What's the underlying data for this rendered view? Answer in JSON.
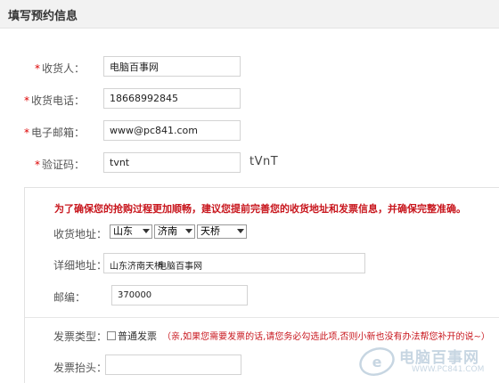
{
  "header": {
    "title": "填写预约信息"
  },
  "form": {
    "required_mark": "*",
    "receiver": {
      "label": "收货人：",
      "value": "电脑百事网"
    },
    "phone": {
      "label": "收货电话：",
      "value": "18668992845"
    },
    "email": {
      "label": "电子邮箱：",
      "value": "www@pc841.com"
    },
    "captcha": {
      "label": "验证码：",
      "value": "tvnt",
      "image_text": "tVnT"
    }
  },
  "panel": {
    "notice": "为了确保您的抢购过程更加顺畅，建议您提前完善您的收货地址和发票信息，并确保完整准确。",
    "region": {
      "label": "收货地址：",
      "province": "山东",
      "city": "济南",
      "district": "天桥"
    },
    "address": {
      "label": "详细地址：",
      "prefix": "山东济南天桥",
      "value": "电脑百事网"
    },
    "postcode": {
      "label": "邮编：",
      "value": "370000"
    },
    "invoice_type": {
      "label": "发票类型：",
      "option": "普通发票",
      "checked": false,
      "hint": "（亲,如果您需要发票的话,请您务必勾选此项,否则小新也没有办法帮您补开的说~）"
    },
    "invoice_title": {
      "label": "发票抬头：",
      "value": ""
    }
  },
  "watermark": {
    "name": "电脑百事网",
    "url": "WWW.PC841.COM"
  },
  "colors": {
    "required": "#dd0000",
    "notice": "#c8161d",
    "header_bg": "#f2f2f2"
  }
}
